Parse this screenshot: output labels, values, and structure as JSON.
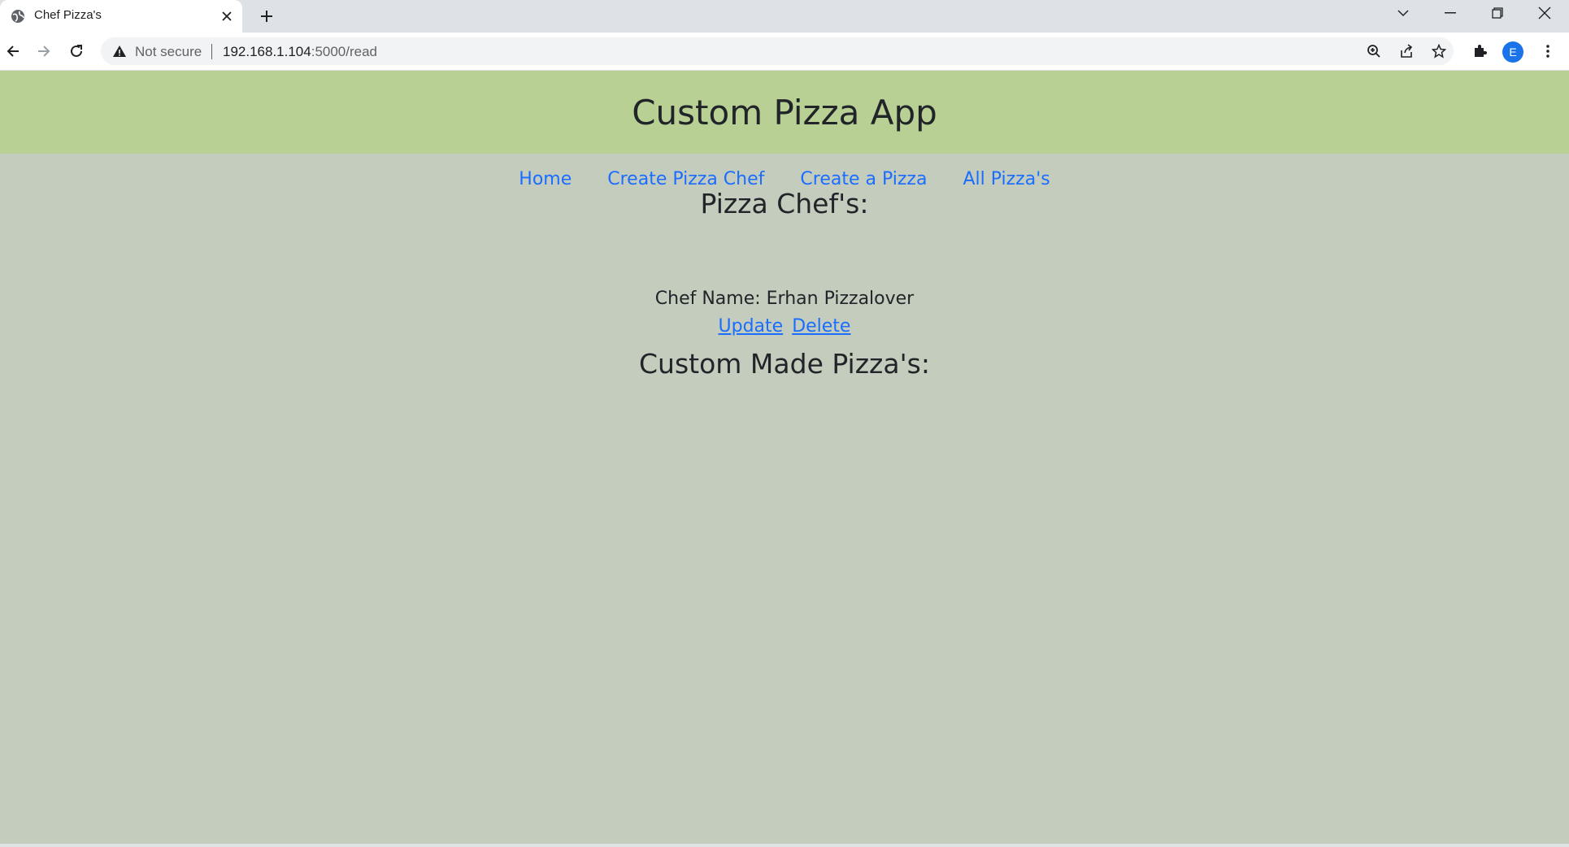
{
  "browser": {
    "tab_title": "Chef Pizza's",
    "security_label": "Not secure",
    "url_host": "192.168.1.104",
    "url_path": ":5000/read",
    "avatar_letter": "E",
    "icons": [
      "globe-icon",
      "close-icon",
      "plus-icon",
      "chevron-down-icon",
      "minimize-icon",
      "restore-icon",
      "window-close-icon",
      "back-icon",
      "forward-icon",
      "reload-icon",
      "warning-icon",
      "zoom-icon",
      "share-icon",
      "star-icon",
      "extensions-icon",
      "more-icon"
    ]
  },
  "app": {
    "title": "Custom Pizza App",
    "header_color": "#b8d093",
    "background_color": "#c4cdbd",
    "link_color": "#1a6dff"
  },
  "nav": {
    "items": [
      {
        "label": "Home"
      },
      {
        "label": "Create Pizza Chef"
      },
      {
        "label": "Create a Pizza"
      },
      {
        "label": "All Pizza's"
      }
    ]
  },
  "chefs": {
    "heading": "Pizza Chef's:",
    "items": [
      {
        "name_line": "Chef Name: Erhan Pizzalover",
        "update_label": "Update",
        "delete_label": "Delete"
      }
    ]
  },
  "pizzas": {
    "heading": "Custom Made Pizza's:"
  }
}
